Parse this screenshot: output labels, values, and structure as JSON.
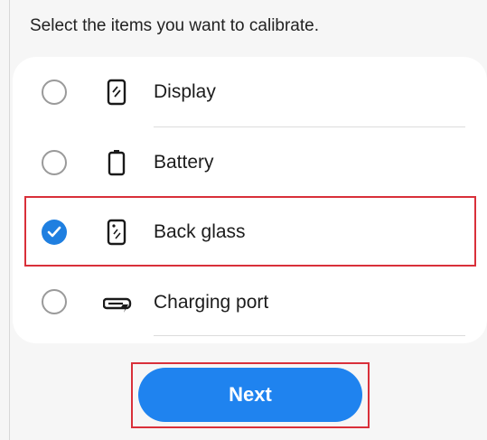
{
  "instruction": "Select the items you want to calibrate.",
  "items": [
    {
      "label": "Display",
      "icon": "phone-display-icon",
      "checked": false
    },
    {
      "label": "Battery",
      "icon": "battery-icon",
      "checked": false
    },
    {
      "label": "Back glass",
      "icon": "phone-back-glass-icon",
      "checked": true
    },
    {
      "label": "Charging port",
      "icon": "charging-port-icon",
      "checked": false
    }
  ],
  "next_button": "Next",
  "colors": {
    "accent": "#1f83ef",
    "highlight": "#d9303a",
    "background": "#f6f6f6",
    "card": "#ffffff"
  }
}
